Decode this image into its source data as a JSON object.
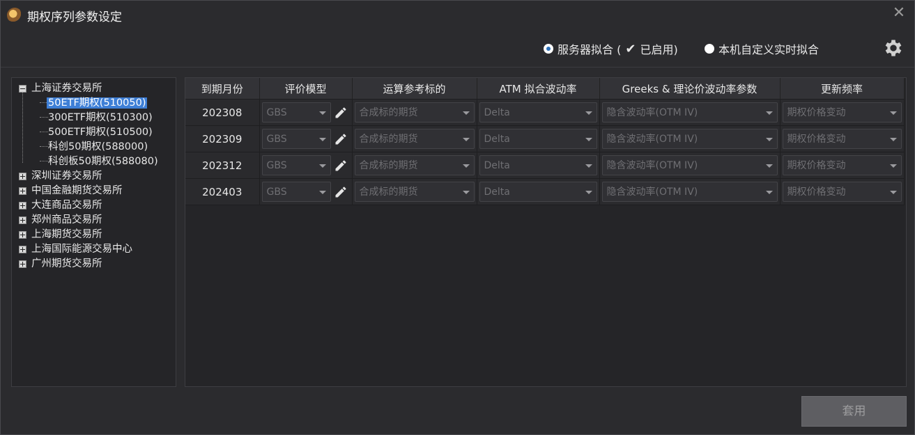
{
  "title": "期权序列参数设定",
  "fit_mode": {
    "server_label": "服务器拟合 (",
    "server_enabled": "已启用)",
    "local_label": "本机自定义实时拟合",
    "selected": "server"
  },
  "tree": {
    "exchanges": [
      {
        "label": "上海证券交易所",
        "expanded": true,
        "children": [
          "50ETF期权(510050)",
          "300ETF期权(510300)",
          "500ETF期权(510500)",
          "科创50期权(588000)",
          "科创板50期权(588080)"
        ],
        "selected_child": 0
      },
      {
        "label": "深圳证券交易所",
        "expanded": false
      },
      {
        "label": "中国金融期货交易所",
        "expanded": false
      },
      {
        "label": "大连商品交易所",
        "expanded": false
      },
      {
        "label": "郑州商品交易所",
        "expanded": false
      },
      {
        "label": "上海期货交易所",
        "expanded": false
      },
      {
        "label": "上海国际能源交易中心",
        "expanded": false
      },
      {
        "label": "广州期货交易所",
        "expanded": false
      }
    ]
  },
  "table": {
    "headers": [
      "到期月份",
      "评价模型",
      "运算参考标的",
      "ATM 拟合波动率",
      "Greeks & 理论价波动率参数",
      "更新频率"
    ],
    "rows": [
      {
        "month": "202308",
        "model": "GBS",
        "underlying": "合成标的期货",
        "atm": "Delta",
        "greeks": "隐含波动率(OTM IV)",
        "freq": "期权价格变动"
      },
      {
        "month": "202309",
        "model": "GBS",
        "underlying": "合成标的期货",
        "atm": "Delta",
        "greeks": "隐含波动率(OTM IV)",
        "freq": "期权价格变动"
      },
      {
        "month": "202312",
        "model": "GBS",
        "underlying": "合成标的期货",
        "atm": "Delta",
        "greeks": "隐含波动率(OTM IV)",
        "freq": "期权价格变动"
      },
      {
        "month": "202403",
        "model": "GBS",
        "underlying": "合成标的期货",
        "atm": "Delta",
        "greeks": "隐含波动率(OTM IV)",
        "freq": "期权价格变动"
      }
    ]
  },
  "apply_label": "套用",
  "icons": {
    "app": "app-logo-icon",
    "close": "close-icon",
    "settings": "gear-icon",
    "edit": "pencil-icon",
    "check": "checkmark-icon"
  },
  "colors": {
    "background": "#2b2b2e",
    "selection": "#3e7fd6",
    "radio_dot": "#2c6fb8"
  }
}
